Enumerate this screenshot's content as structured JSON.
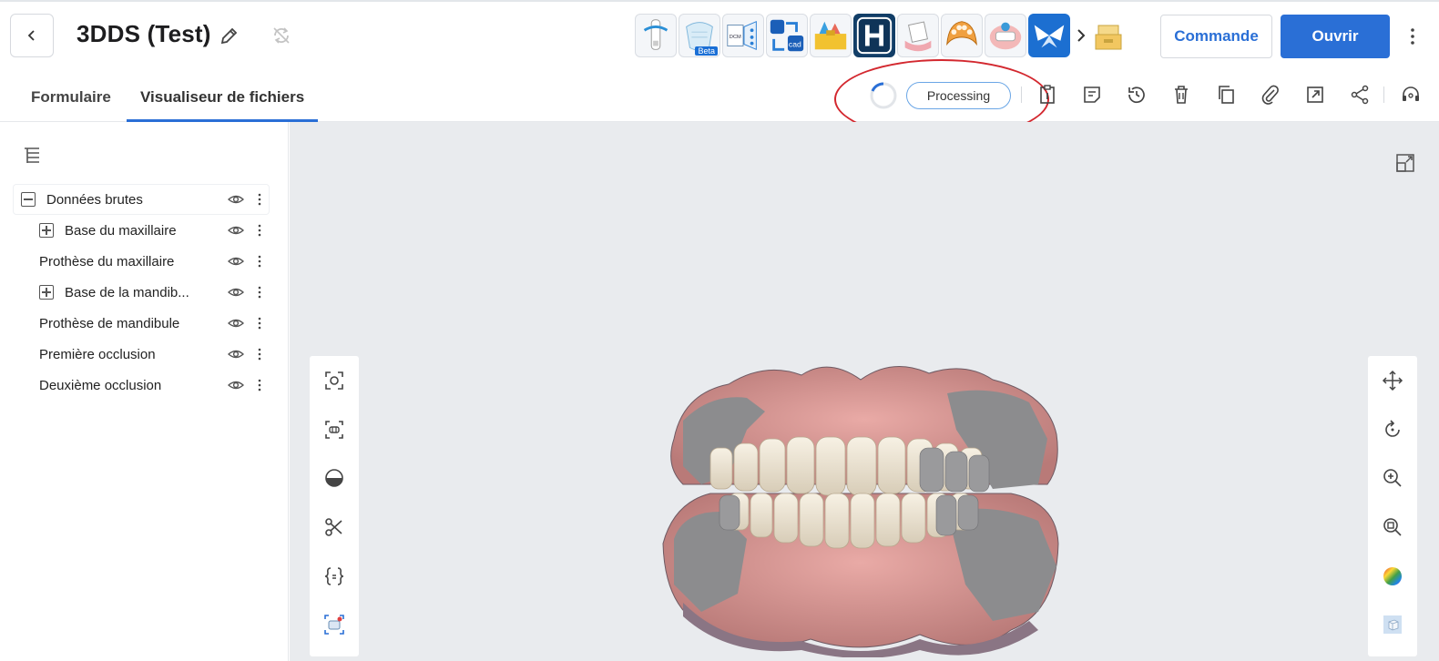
{
  "header": {
    "title": "3DDS (Test)",
    "commande_label": "Commande",
    "ouvrir_label": "Ouvrir",
    "beta_label": "Beta"
  },
  "apps": [
    {
      "name": "scan-app-icon"
    },
    {
      "name": "crown-beta-app-icon"
    },
    {
      "name": "dicom-app-icon"
    },
    {
      "name": "cad-app-icon"
    },
    {
      "name": "toolbox-app-icon"
    },
    {
      "name": "h-app-icon"
    },
    {
      "name": "model-app-icon"
    },
    {
      "name": "denture-app-icon"
    },
    {
      "name": "bite-app-icon"
    },
    {
      "name": "butterfly-app-icon"
    }
  ],
  "tabs": {
    "formulaire": "Formulaire",
    "viewer": "Visualiseur de fichiers"
  },
  "status": {
    "label": "Processing"
  },
  "tree": {
    "items": [
      {
        "label": "Données brutes"
      },
      {
        "label": "Base du maxillaire"
      },
      {
        "label": "Prothèse du maxillaire"
      },
      {
        "label": "Base de la mandib..."
      },
      {
        "label": "Prothèse de mandibule"
      },
      {
        "label": "Première occlusion"
      },
      {
        "label": "Deuxième occlusion"
      }
    ]
  },
  "colors": {
    "accent": "#2a6fd6",
    "highlight": "#d3282f",
    "viewer_bg": "#e9ebee"
  }
}
